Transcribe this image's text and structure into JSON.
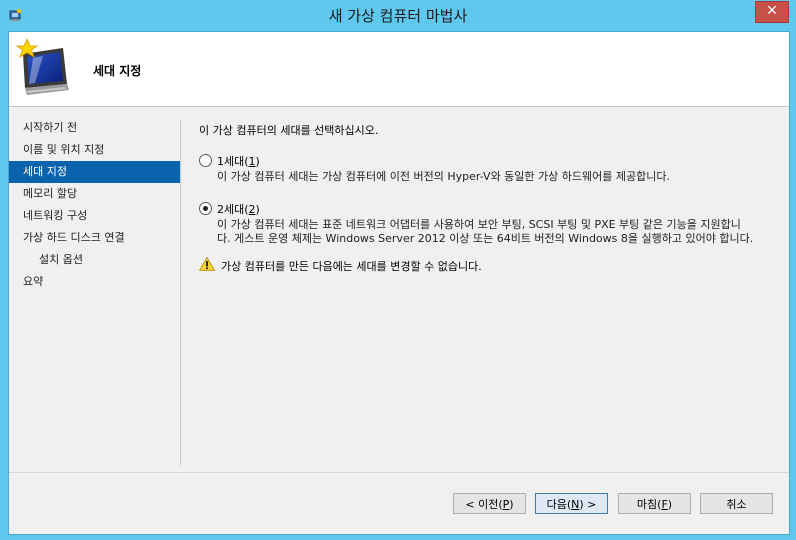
{
  "window": {
    "title": "새 가상 컴퓨터 마법사",
    "close_glyph": "✕"
  },
  "header": {
    "title": "세대 지정"
  },
  "sidebar": {
    "items": [
      {
        "label": "시작하기 전"
      },
      {
        "label": "이름 및 위치 지정"
      },
      {
        "label": "세대 지정"
      },
      {
        "label": "메모리 할당"
      },
      {
        "label": "네트워킹 구성"
      },
      {
        "label": "가상 하드 디스크 연결"
      },
      {
        "label": "설치 옵션"
      },
      {
        "label": "요약"
      }
    ]
  },
  "content": {
    "prompt": "이 가상 컴퓨터의 세대를 선택하십시오.",
    "gen1": {
      "label_prefix": "1세대(",
      "hotkey": "1",
      "label_suffix": ")",
      "desc": "이 가상 컴퓨터 세대는 가상 컴퓨터에 이전 버전의 Hyper-V와 동일한 가상 하드웨어를 제공합니다.",
      "selected": false
    },
    "gen2": {
      "label_prefix": "2세대(",
      "hotkey": "2",
      "label_suffix": ")",
      "desc1": "이 가상 컴퓨터 세대는 표준 네트워크 어댑터를 사용하여 보안 부팅, SCSI 부팅 및 PXE 부팅 같은 기능을 지원합니",
      "desc2": "다. 게스트 운영 체제는 Windows Server 2012 이상 또는 64비트 버전의 Windows 8을 실행하고 있어야 합니다.",
      "selected": true
    },
    "warning": "가상 컴퓨터를 만든 다음에는 세대를 변경할 수 없습니다."
  },
  "buttons": {
    "prev": {
      "prefix": "< 이전(",
      "hotkey": "P",
      "suffix": ")"
    },
    "next": {
      "prefix": "다음(",
      "hotkey": "N",
      "suffix": ") >"
    },
    "finish": {
      "prefix": "마침(",
      "hotkey": "F",
      "suffix": ")"
    },
    "cancel": {
      "label": "취소"
    }
  },
  "colors": {
    "title_bar": "#5fc8ec",
    "selection": "#0a64ad",
    "close_button": "#c7504a"
  }
}
